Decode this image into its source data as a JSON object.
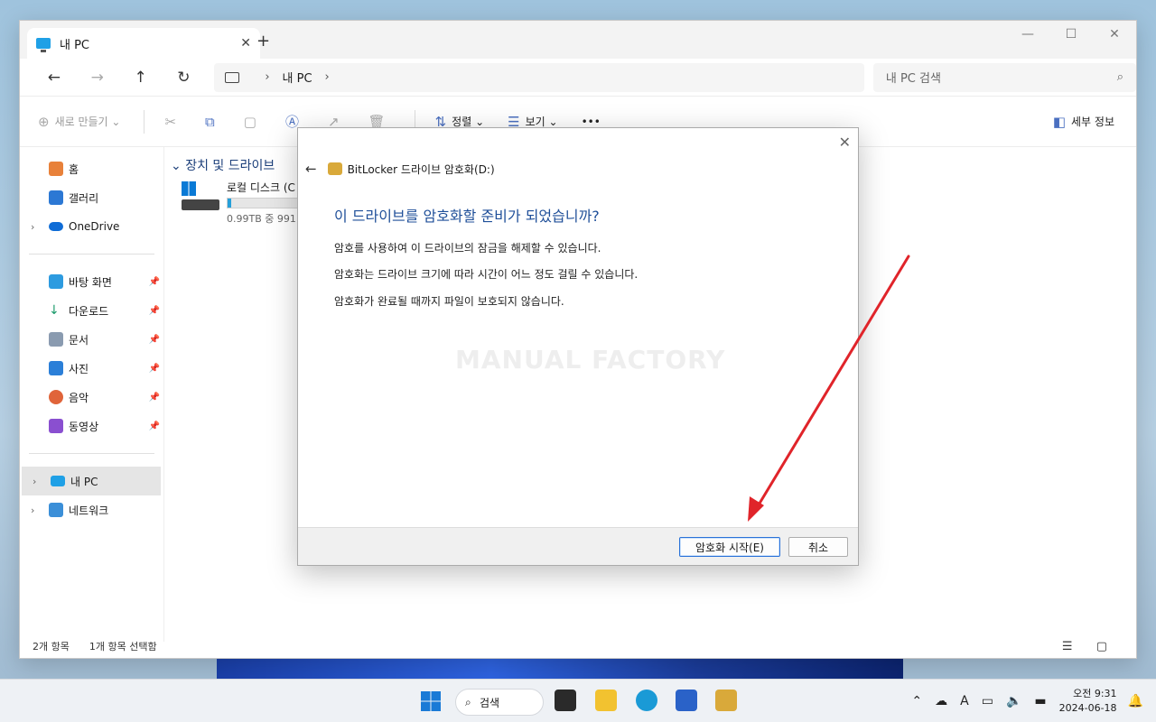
{
  "explorer": {
    "tab_title": "내 PC",
    "new_tab": "+",
    "address": {
      "location": "내 PC"
    },
    "search_placeholder": "내 PC 검색",
    "toolbar": {
      "new_label": "새로 만들기",
      "sort_label": "정렬",
      "view_label": "보기",
      "more_label": "•••",
      "details_label": "세부 정보"
    },
    "sidebar": {
      "quick": [
        {
          "label": "홈"
        },
        {
          "label": "갤러리"
        },
        {
          "label": "OneDrive"
        }
      ],
      "pinned": [
        {
          "label": "바탕 화면"
        },
        {
          "label": "다운로드"
        },
        {
          "label": "문서"
        },
        {
          "label": "사진"
        },
        {
          "label": "음악"
        },
        {
          "label": "동영상"
        }
      ],
      "this_pc": "내 PC",
      "network": "네트워크"
    },
    "content": {
      "group_header": "장치 및 드라이브",
      "drive_name": "로컬 디스크 (C",
      "drive_sub": "0.99TB 중 991",
      "drive_used_fraction": 0.05
    },
    "status": {
      "items": "2개 항목",
      "selected": "1개 항목 선택함"
    }
  },
  "dialog": {
    "header": "BitLocker 드라이브 암호화(D:)",
    "title": "이 드라이브를 암호화할 준비가 되었습니까?",
    "lines": [
      "암호를 사용하여 이 드라이브의 잠금을 해제할 수 있습니다.",
      "암호화는 드라이브 크기에 따라 시간이 어느 정도 걸릴 수 있습니다.",
      "암호화가 완료될 때까지 파일이 보호되지 않습니다."
    ],
    "watermark": "MANUAL FACTORY",
    "start_button": "암호화 시작(E)",
    "cancel_button": "취소"
  },
  "taskbar": {
    "search_label": "검색",
    "ime": "A",
    "time": "오전 9:31",
    "date": "2024-06-18"
  },
  "colors": {
    "accent": "#1f4f99",
    "arrow": "#e0242a",
    "selection": "#e5e5e5"
  }
}
